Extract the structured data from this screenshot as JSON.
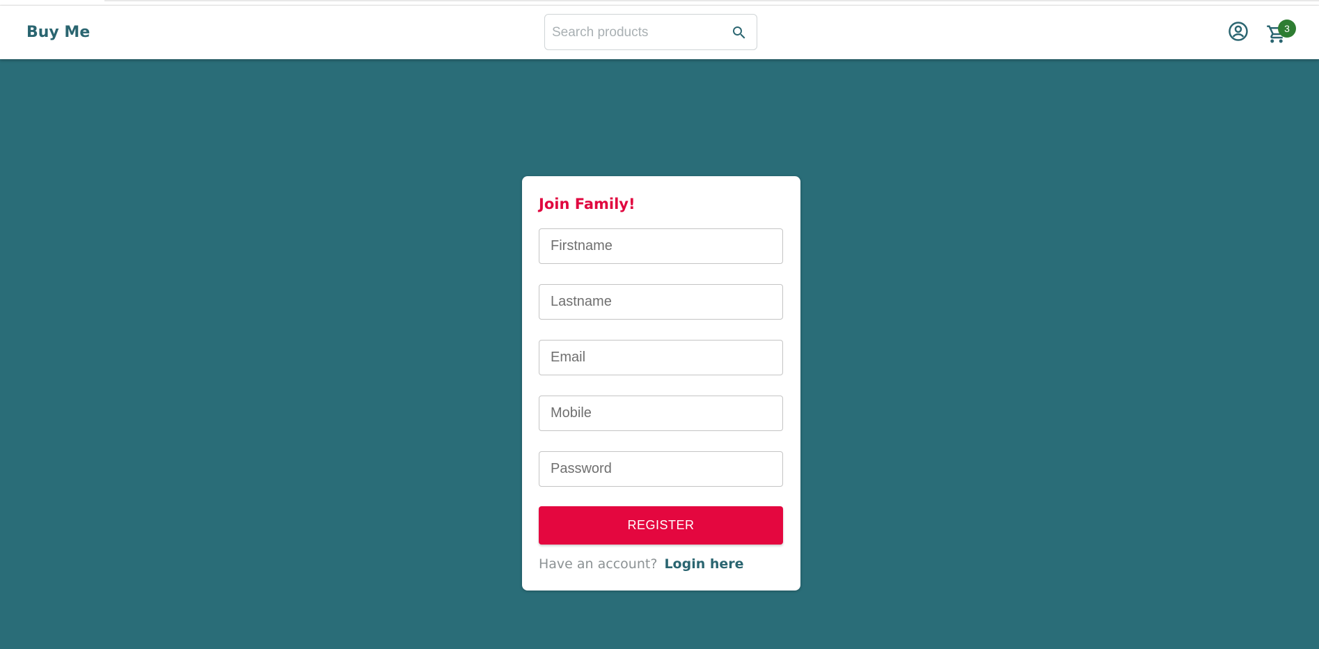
{
  "header": {
    "brand": "Buy Me",
    "search_placeholder": "Search products",
    "cart_count": "3"
  },
  "register_card": {
    "title": "Join Family!",
    "fields": {
      "firstname_placeholder": "Firstname",
      "lastname_placeholder": "Lastname",
      "email_placeholder": "Email",
      "mobile_placeholder": "Mobile",
      "password_placeholder": "Password"
    },
    "register_label": "REGISTER",
    "have_account_text": "Have an account?",
    "login_link_label": "Login here"
  },
  "colors": {
    "background": "#2a6d78",
    "brand": "#2a6570",
    "accent": "#e4073f",
    "badge": "#2e7d32"
  },
  "icons": {
    "search": "search-icon",
    "user": "account-circle-icon",
    "cart": "shopping-cart-icon"
  }
}
